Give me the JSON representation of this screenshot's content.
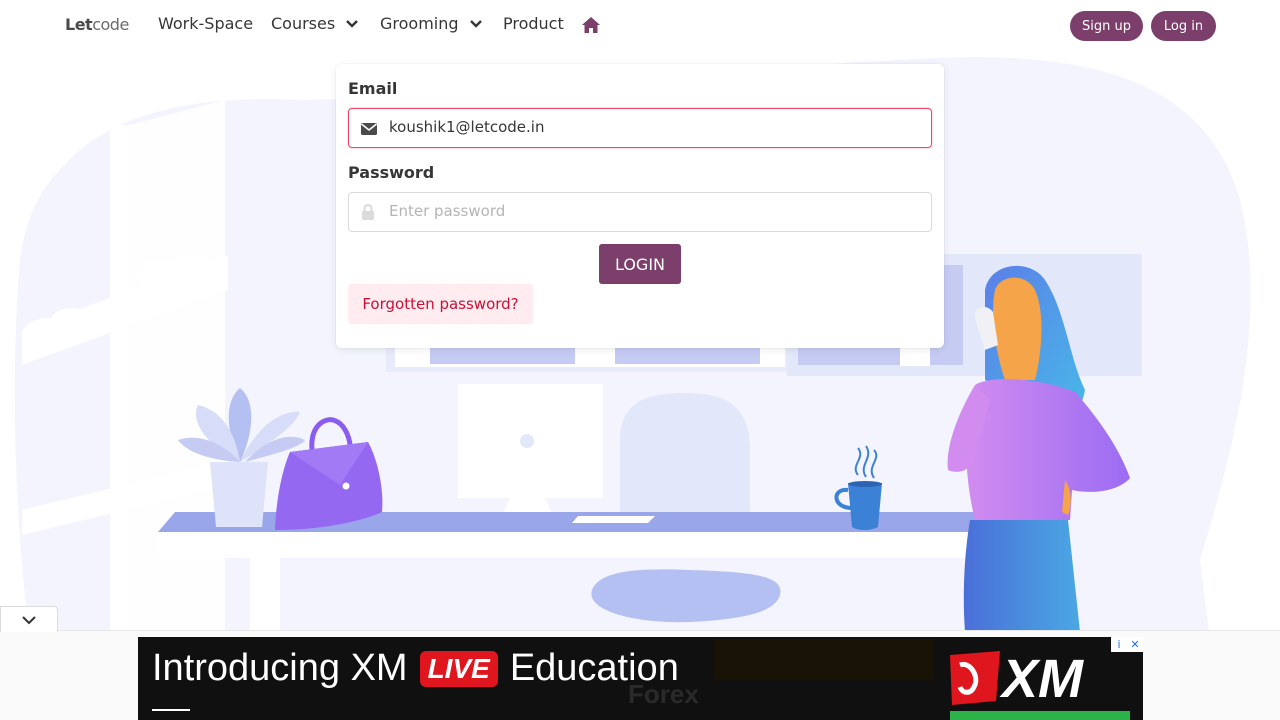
{
  "nav": {
    "logo_let": "Let",
    "logo_code": "code",
    "items": [
      {
        "label": "Work-Space"
      },
      {
        "label": "Courses"
      },
      {
        "label": "Grooming"
      },
      {
        "label": "Product"
      }
    ],
    "signup_label": "Sign up",
    "login_label": "Log in"
  },
  "form": {
    "email_label": "Email",
    "email_value": "koushik1@letcode.in",
    "password_label": "Password",
    "password_placeholder": "Enter password",
    "login_button": "LOGIN",
    "forgot_label": "Forgotten password?"
  },
  "ad": {
    "text_before": "Introducing XM",
    "live": "LIVE",
    "text_after": "Education",
    "ghost_text": "Forex",
    "brand": "XM",
    "info_icon": "i",
    "close_icon": "✕"
  },
  "colors": {
    "primary": "#7c3e6b",
    "danger": "#f14668",
    "danger_light": "#feecf0",
    "illustration_bg": "#f3f4fd",
    "illustration_accent": "#9aa6ea"
  },
  "icons": {
    "email": "envelope-icon",
    "password": "lock-icon",
    "home": "home-icon",
    "collapse": "chevron-down-icon"
  }
}
